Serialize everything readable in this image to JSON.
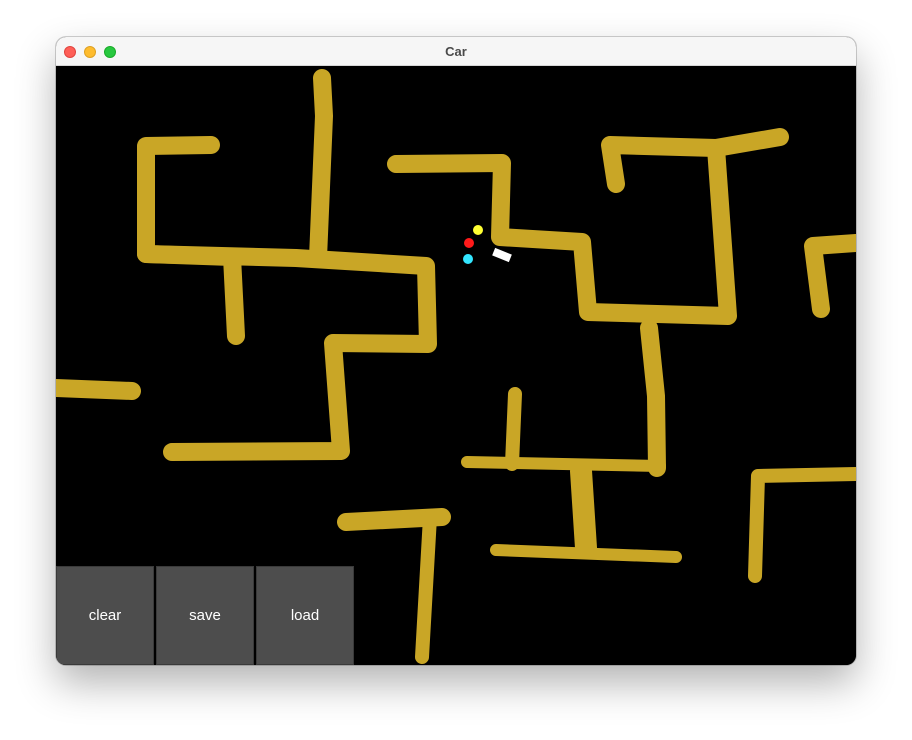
{
  "window": {
    "title": "Car"
  },
  "toolbar": {
    "clear_label": "clear",
    "save_label": "save",
    "load_label": "load"
  },
  "colors": {
    "wall": "#c9a626",
    "background": "#000000",
    "car": "#ffffff",
    "sensor_front": "#ffff33",
    "sensor_middle": "#ff1a1a",
    "sensor_rear": "#33e6ff",
    "button_bg": "#4d4d4d"
  }
}
